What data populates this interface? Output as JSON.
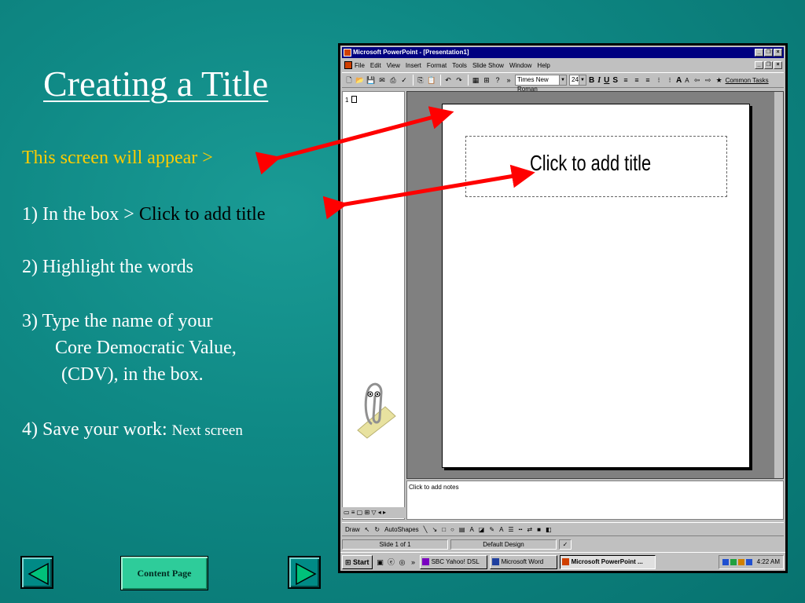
{
  "slide": {
    "title": "Creating a Title",
    "intro": "This screen will appear >",
    "step1_prefix": "1) In the box > ",
    "step1_highlight": "Click to add title",
    "step2": "2) Highlight the words",
    "step3_line1": "3) Type the name of your",
    "step3_line2": "Core Democratic Value,",
    "step3_line3": "(CDV), in the box.",
    "step4_prefix": "4) Save your work: ",
    "step4_suffix": "Next screen",
    "content_button": "Content Page",
    "colors": {
      "background": "#0f8985",
      "intro": "#ffcc00",
      "arrow": "#ff0000"
    }
  },
  "ppt": {
    "window_title": "Microsoft PowerPoint - [Presentation1]",
    "menus": [
      "File",
      "Edit",
      "View",
      "Insert",
      "Format",
      "Tools",
      "Slide Show",
      "Window",
      "Help"
    ],
    "font_name": "Times New Roman",
    "font_size": "24",
    "common_tasks": "Common Tasks",
    "slide_number": "1",
    "title_placeholder": "Click to add title",
    "notes_placeholder": "Click to add notes",
    "draw_label": "Draw",
    "autoshapes_label": "AutoShapes",
    "status_slide": "Slide 1 of 1",
    "status_design": "Default Design",
    "taskbar": {
      "start": "Start",
      "items": [
        "SBC Yahoo! DSL",
        "Microsoft Word",
        "Microsoft PowerPoint ..."
      ],
      "clock": "4:22 AM"
    }
  }
}
